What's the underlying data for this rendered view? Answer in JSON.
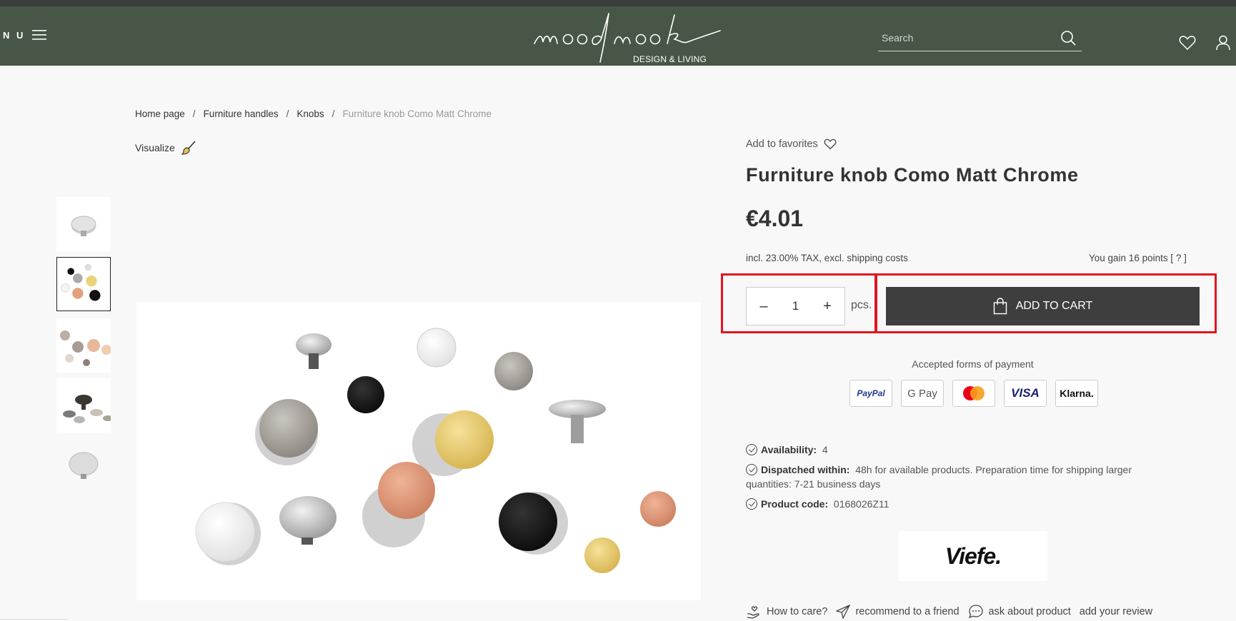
{
  "header": {
    "menu_label": "N U",
    "logo_text": "moodnook",
    "logo_subtitle": "DESIGN & LIVING",
    "search_placeholder": "Search",
    "icons": [
      "menu-icon",
      "search-icon",
      "heart-icon",
      "user-icon"
    ]
  },
  "breadcrumb": {
    "items": [
      "Home page",
      "Furniture handles",
      "Knobs"
    ],
    "separator": "/",
    "current": "Furniture knob Como Matt Chrome"
  },
  "visualize_label": "Visualize",
  "thumbnails": [
    {
      "alt": "Knob thumbnail 1",
      "active": false
    },
    {
      "alt": "Knob thumbnail 2",
      "active": true
    },
    {
      "alt": "Knob thumbnail 3",
      "active": false
    },
    {
      "alt": "Knob thumbnail 4",
      "active": false
    },
    {
      "alt": "Knob thumbnail 5",
      "active": false
    }
  ],
  "product": {
    "add_to_favorites": "Add to favorites",
    "title": "Furniture knob Como Matt Chrome",
    "price": "€4.01",
    "tax_note": "incl. 23.00% TAX, excl. shipping costs",
    "points_note": "You gain 16 points [ ? ]",
    "quantity": "1",
    "qty_minus": "–",
    "qty_plus": "+",
    "unit": "pcs.",
    "add_to_cart": "ADD TO CART"
  },
  "payment": {
    "title": "Accepted forms of payment",
    "methods": [
      "PayPal",
      "G Pay",
      "Mastercard",
      "VISA",
      "Klarna."
    ]
  },
  "details": {
    "availability_label": "Availability:",
    "availability_value": "4",
    "dispatch_label": "Dispatched within:",
    "dispatch_value": "48h for available products. Preparation time for shipping larger",
    "dispatch_value_2": "quantities: 7-21 business days",
    "code_label": "Product code:",
    "code_value": "0168026Z11"
  },
  "brand_logo": "Viefe.",
  "bottom_links": {
    "care": "How to care?",
    "recommend": "recommend to a friend",
    "ask": "ask about product",
    "review": "add your review"
  },
  "colors": {
    "header_bg": "#475646",
    "cart_button": "#3e3e3e",
    "highlight": "#e1141f"
  }
}
